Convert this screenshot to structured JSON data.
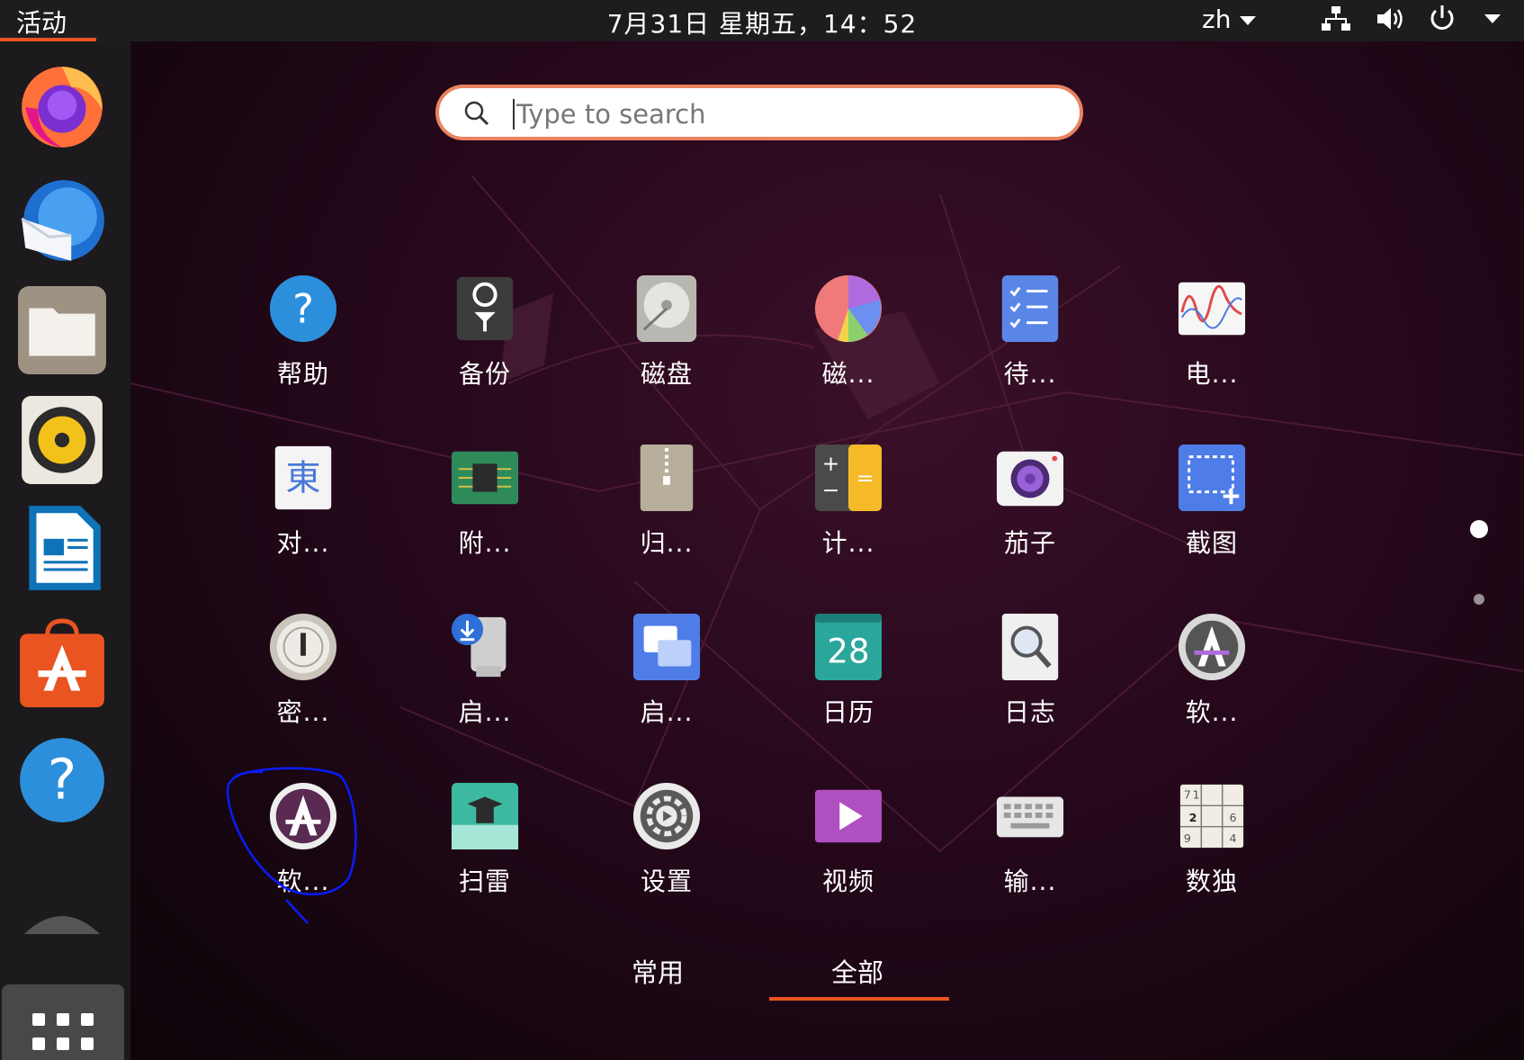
{
  "topbar": {
    "activities": "活动",
    "clock": "7月31日 星期五，14：52",
    "lang": "zh",
    "network_icon": "network-icon",
    "volume_icon": "volume-icon",
    "power_icon": "power-icon"
  },
  "dock": {
    "items": [
      {
        "name": "firefox",
        "icon": "firefox-icon"
      },
      {
        "name": "thunderbird",
        "icon": "thunderbird-icon"
      },
      {
        "name": "files",
        "icon": "folder-icon"
      },
      {
        "name": "rhythmbox",
        "icon": "speaker-icon"
      },
      {
        "name": "libreoffice-writer",
        "icon": "document-icon"
      },
      {
        "name": "ubuntu-software",
        "icon": "store-icon"
      },
      {
        "name": "help",
        "icon": "help-icon"
      }
    ],
    "apps_button_icon": "app-grid-icon"
  },
  "search": {
    "placeholder": "Type to search"
  },
  "apps": [
    {
      "label": "帮助",
      "icon": "help-icon"
    },
    {
      "label": "备份",
      "icon": "backup-icon"
    },
    {
      "label": "磁盘",
      "icon": "disk-icon"
    },
    {
      "label": "磁...",
      "icon": "disk-usage-icon"
    },
    {
      "label": "待...",
      "icon": "todo-icon"
    },
    {
      "label": "电...",
      "icon": "power-stats-icon"
    },
    {
      "label": "对...",
      "icon": "character-map-icon"
    },
    {
      "label": "附...",
      "icon": "chip-icon"
    },
    {
      "label": "归...",
      "icon": "archive-icon"
    },
    {
      "label": "计...",
      "icon": "calculator-icon"
    },
    {
      "label": "茄子",
      "icon": "camera-icon"
    },
    {
      "label": "截图",
      "icon": "screenshot-icon"
    },
    {
      "label": "密...",
      "icon": "password-icon"
    },
    {
      "label": "启...",
      "icon": "startup-disk-icon"
    },
    {
      "label": "启...",
      "icon": "startup-apps-icon"
    },
    {
      "label": "日历",
      "icon": "calendar-icon"
    },
    {
      "label": "日志",
      "icon": "logs-icon"
    },
    {
      "label": "软...",
      "icon": "software-updater-icon"
    },
    {
      "label": "软...",
      "icon": "software-properties-icon"
    },
    {
      "label": "扫雷",
      "icon": "mines-icon"
    },
    {
      "label": "设置",
      "icon": "settings-icon"
    },
    {
      "label": "视频",
      "icon": "videos-icon"
    },
    {
      "label": "输...",
      "icon": "keyboard-icon"
    },
    {
      "label": "数独",
      "icon": "sudoku-icon"
    }
  ],
  "calendar_day": "28",
  "tabs": {
    "frequent": "常用",
    "all": "全部"
  },
  "colors": {
    "accent": "#e95420",
    "topbar": "#1d1d1d",
    "dock": "#1c1a1c"
  }
}
